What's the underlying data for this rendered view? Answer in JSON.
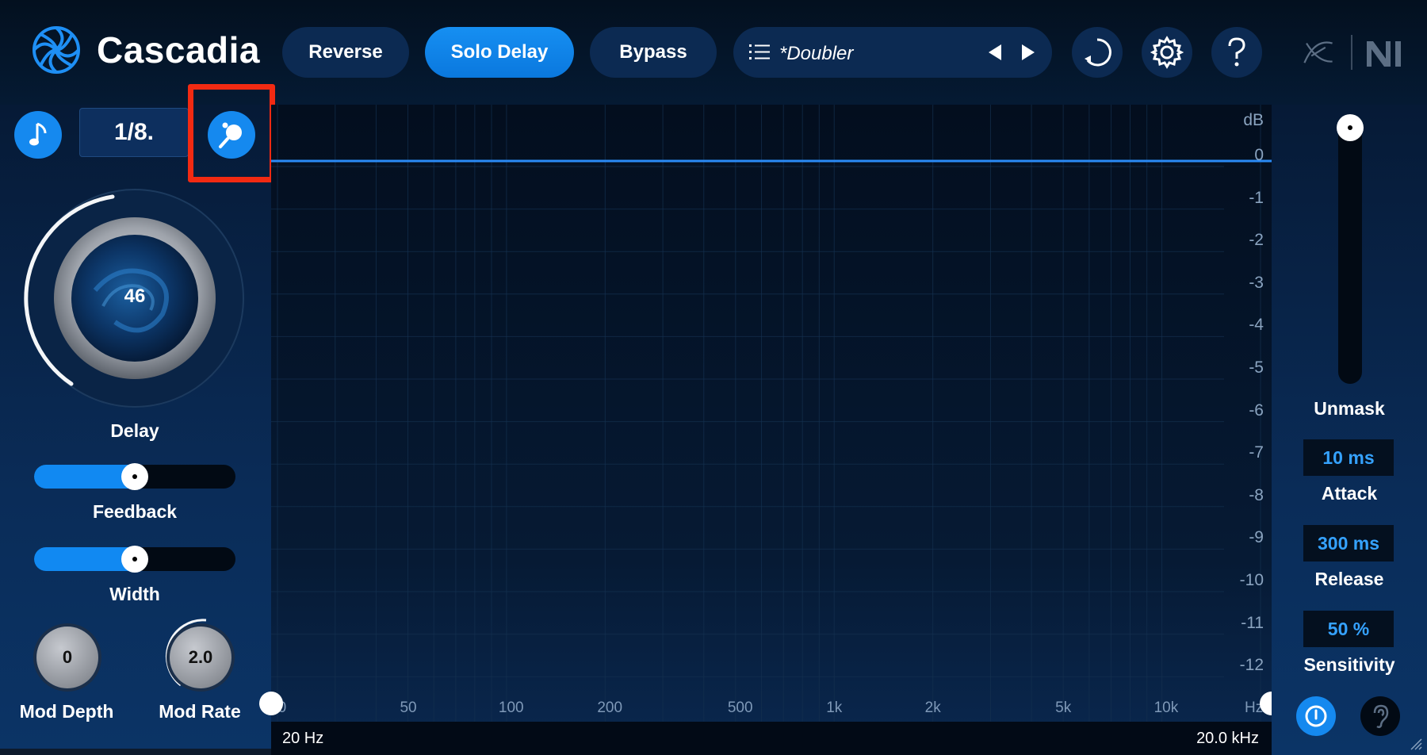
{
  "app": {
    "title": "Cascadia"
  },
  "header": {
    "reverse_label": "Reverse",
    "solo_delay_label": "Solo Delay",
    "bypass_label": "Bypass",
    "preset_name": "*Doubler",
    "icons": {
      "logo": "spiral-logo-icon",
      "preset_list": "list-icon",
      "prev": "triangle-left-icon",
      "next": "triangle-right-icon",
      "history": "history-loop-icon",
      "settings": "gear-icon",
      "help": "question-icon",
      "brand_izotope": "izotope-brand-icon",
      "brand_ni": "ni-brand-icon"
    },
    "solo_delay_active": true
  },
  "left_panel": {
    "sync_icon": "music-note-icon",
    "note_division": "1/8.",
    "pingpong_icon": "ping-pong-icon",
    "delay": {
      "label": "Delay",
      "value": "46"
    },
    "feedback": {
      "label": "Feedback",
      "level": 0.5
    },
    "width": {
      "label": "Width",
      "level": 0.5
    },
    "mod_depth": {
      "label": "Mod Depth",
      "value": "0"
    },
    "mod_rate": {
      "label": "Mod Rate",
      "value": "2.0"
    }
  },
  "graph": {
    "db_unit": "dB",
    "db_ticks": [
      "0",
      "-1",
      "-2",
      "-3",
      "-4",
      "-5",
      "-6",
      "-7",
      "-8",
      "-9",
      "-10",
      "-11",
      "-12"
    ],
    "hz_ticks": [
      "20",
      "50",
      "100",
      "200",
      "500",
      "1k",
      "2k",
      "5k",
      "10k",
      "Hz"
    ],
    "range_min": "20 Hz",
    "range_max": "20.0 kHz",
    "curve_db": 0
  },
  "right_panel": {
    "unmask": {
      "label": "Unmask",
      "level": 1.0
    },
    "attack": {
      "label": "Attack",
      "value": "10 ms"
    },
    "release": {
      "label": "Release",
      "value": "300 ms"
    },
    "sensitivity": {
      "label": "Sensitivity",
      "value": "50 %"
    },
    "icons": {
      "power": "power-icon",
      "listen": "ear-icon"
    }
  },
  "colors": {
    "accent": "#1589ef",
    "highlight": "#f22a12",
    "value_text": "#35a2ff"
  }
}
